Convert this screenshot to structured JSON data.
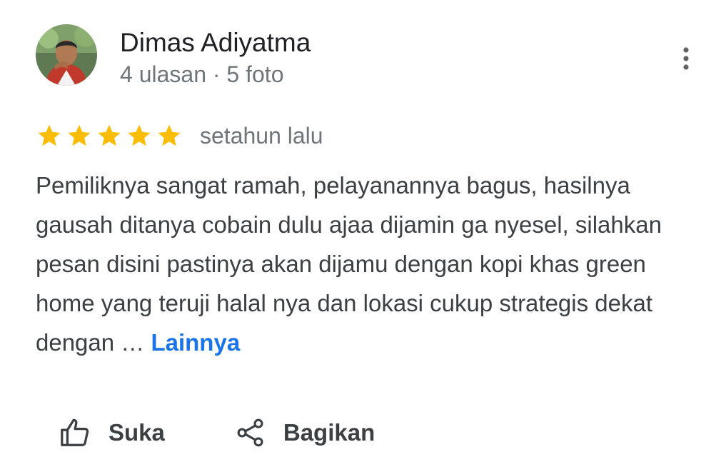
{
  "review": {
    "author": {
      "name": "Dimas Adiyatma",
      "meta": "4 ulasan · 5 foto",
      "avatar_icon": "profile-photo"
    },
    "rating": 5,
    "rating_max": 5,
    "date": "setahun lalu",
    "text": "Pemiliknya sangat ramah, pelayanannya bagus, hasilnya gausah ditanya cobain dulu ajaa dijamin ga nyesel, silahkan pesan disini pastinya akan dijamu dengan kopi khas green home yang teruji halal nya dan lokasi cukup strategis dekat dengan …",
    "more_label": "Lainnya",
    "menu_icon": "more-vert-icon"
  },
  "actions": {
    "like_label": "Suka",
    "like_icon": "thumb-up-icon",
    "share_label": "Bagikan",
    "share_icon": "share-icon"
  },
  "colors": {
    "star": "#fbbc04",
    "link": "#1a73e8",
    "secondary_text": "#70757a",
    "primary_text": "#202124"
  }
}
